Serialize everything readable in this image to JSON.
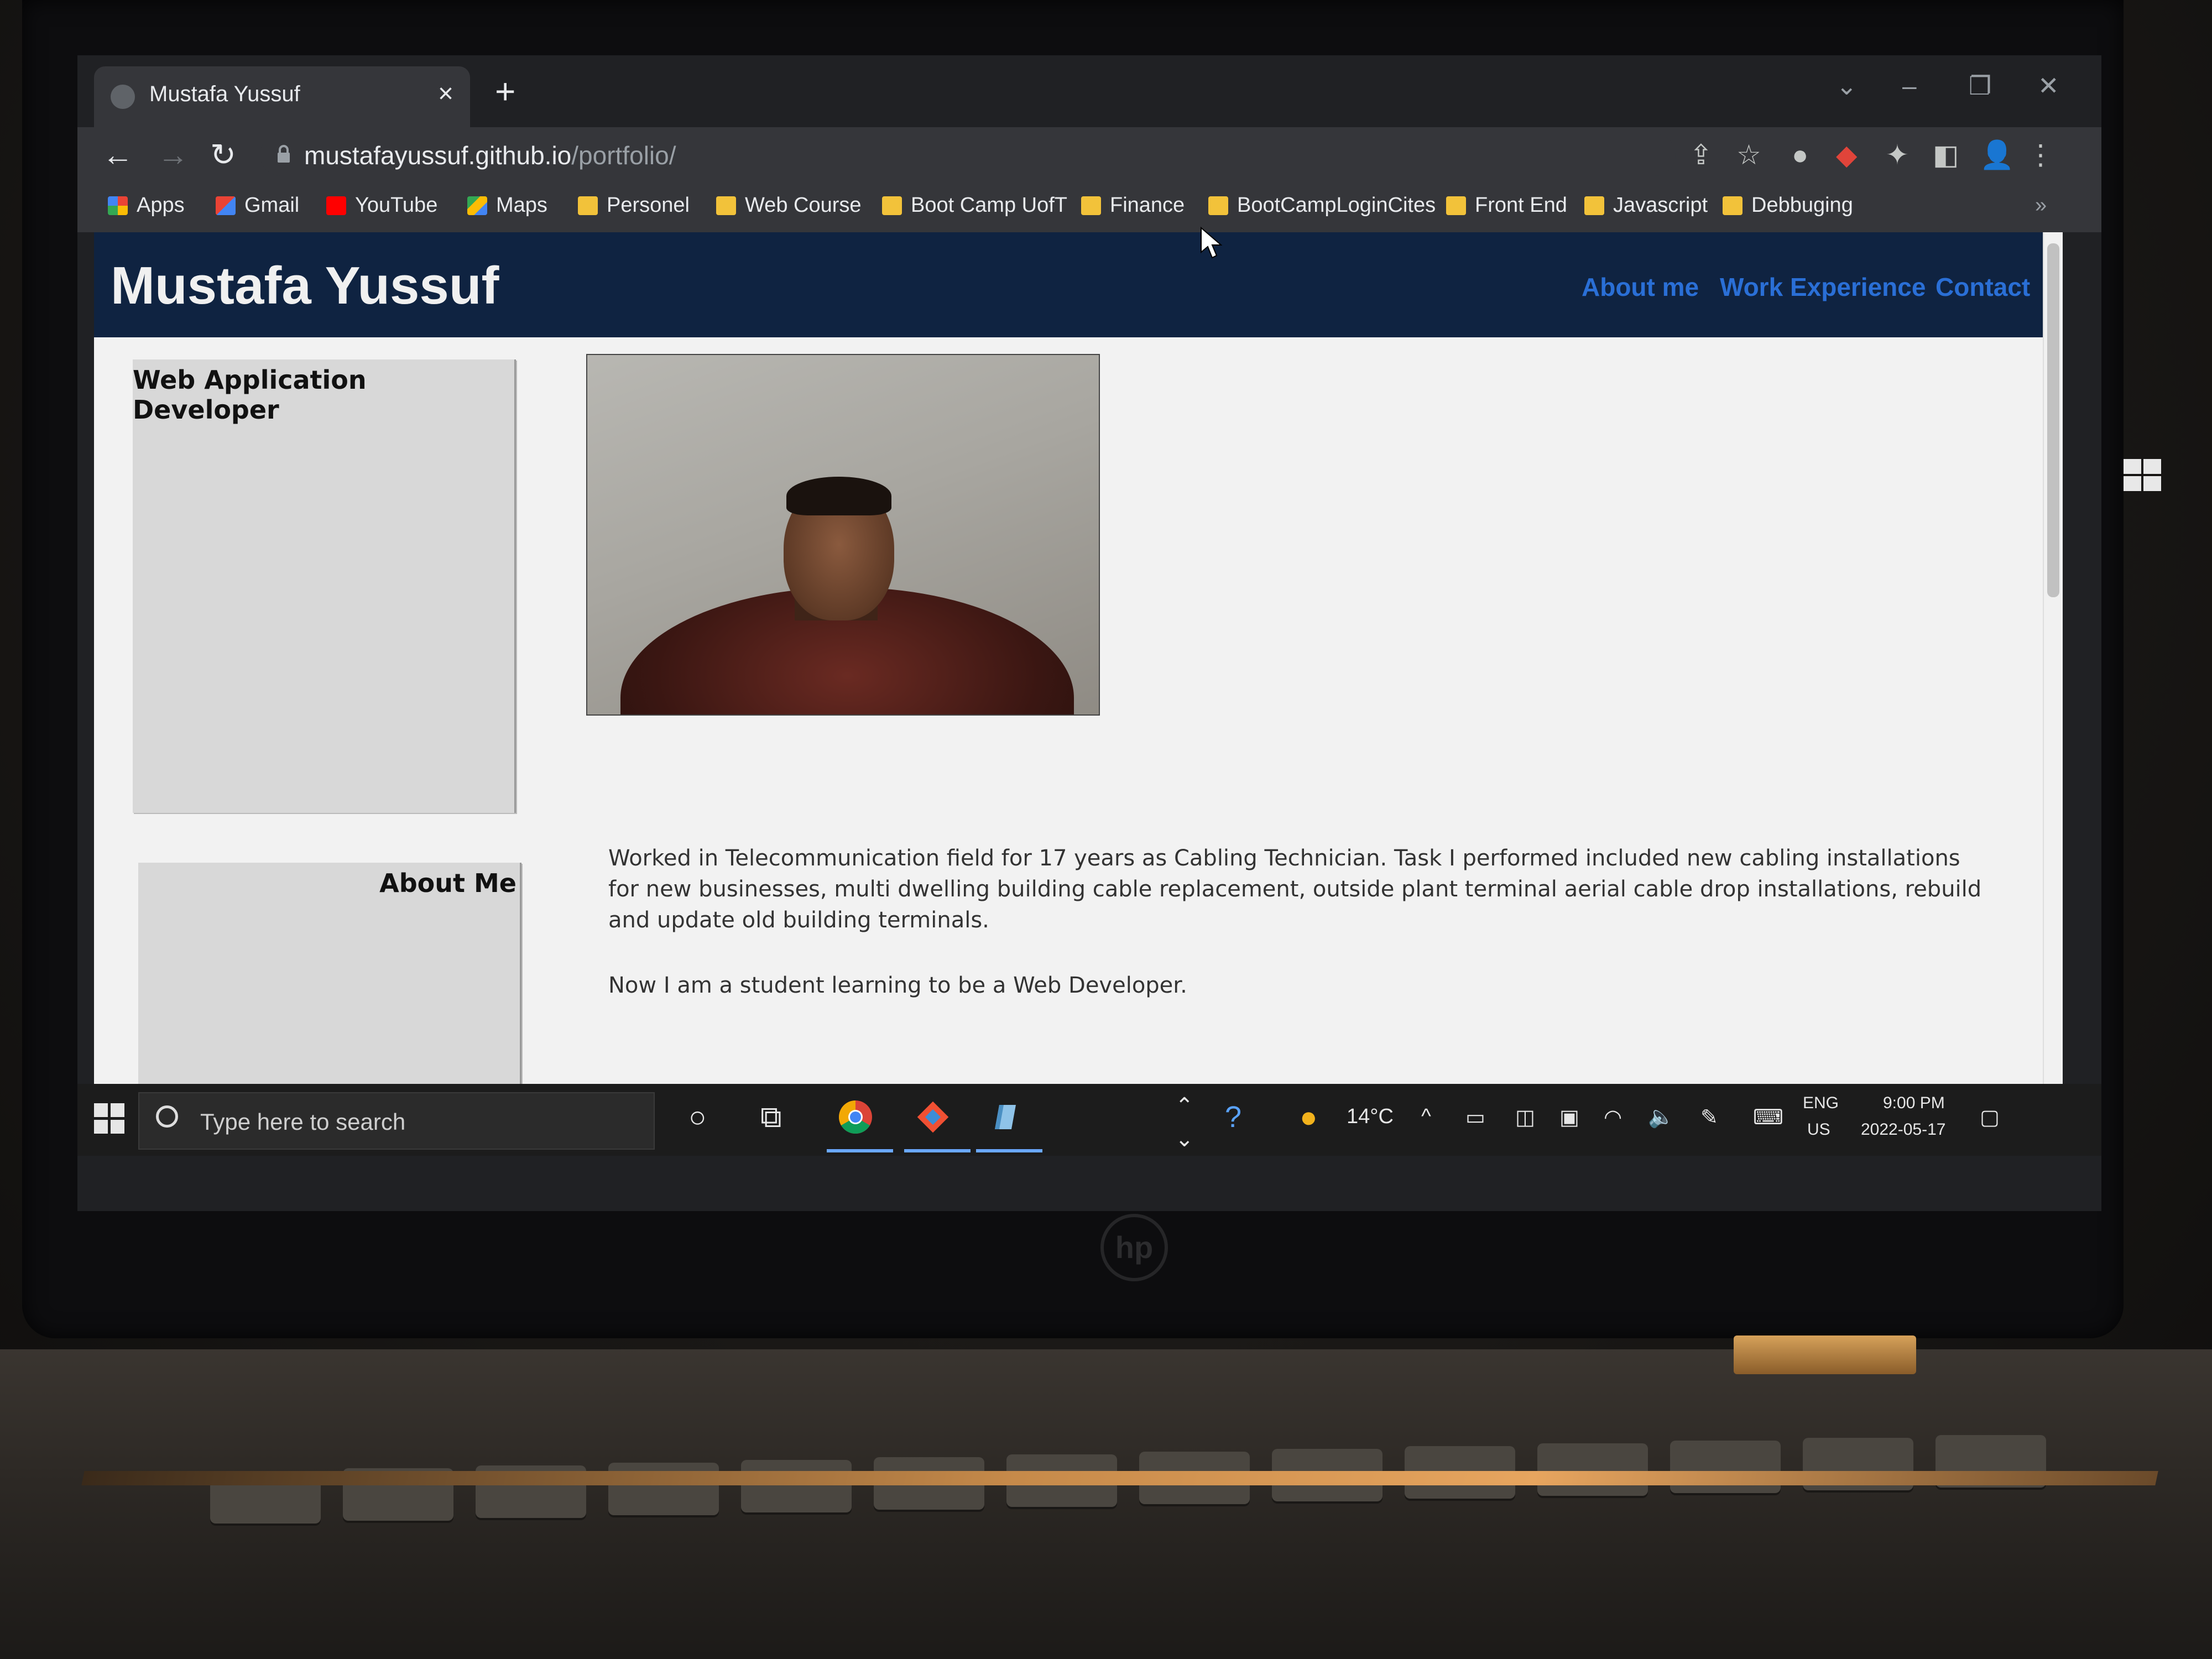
{
  "browser": {
    "tab_title": "Mustafa Yussuf",
    "url_host": "mustafayussuf.github.io",
    "url_path": "/portfolio/",
    "bookmarks": [
      {
        "label": "Apps",
        "icon": "apps-grid-icon"
      },
      {
        "label": "Gmail",
        "icon": "gmail-icon"
      },
      {
        "label": "YouTube",
        "icon": "youtube-icon"
      },
      {
        "label": "Maps",
        "icon": "maps-icon"
      },
      {
        "label": "Personel",
        "icon": "folder-icon"
      },
      {
        "label": "Web Course",
        "icon": "folder-icon"
      },
      {
        "label": "Boot Camp UofT",
        "icon": "folder-icon"
      },
      {
        "label": "Finance",
        "icon": "folder-icon"
      },
      {
        "label": "BootCampLoginCites",
        "icon": "folder-icon"
      },
      {
        "label": "Front End",
        "icon": "folder-icon"
      },
      {
        "label": "Javascript",
        "icon": "folder-icon"
      },
      {
        "label": "Debbuging",
        "icon": "folder-icon"
      }
    ]
  },
  "site": {
    "name": "Mustafa Yussuf",
    "nav": [
      "About me",
      "Work Experience",
      "Contact"
    ],
    "sections": {
      "role_title": "Web Application Developer",
      "about_title": "About Me",
      "about_p1": "Worked in Telecommunication field for 17 years as Cabling Technician. Task I performed included new cabling installations for new businesses, multi dwelling building cable replacement, outside plant terminal aerial cable drop installations, rebuild and update old building terminals.",
      "about_p2": "Now I am a student learning to be a Web Developer."
    }
  },
  "taskbar": {
    "search_placeholder": "Type here to search",
    "temperature": "14°C",
    "lang": "ENG",
    "region": "US",
    "time": "9:00 PM",
    "date": "2022-05-17"
  },
  "colors": {
    "site_header": "#0f2341",
    "nav_link": "#2a6fd6",
    "browser_chrome": "#35363a"
  }
}
